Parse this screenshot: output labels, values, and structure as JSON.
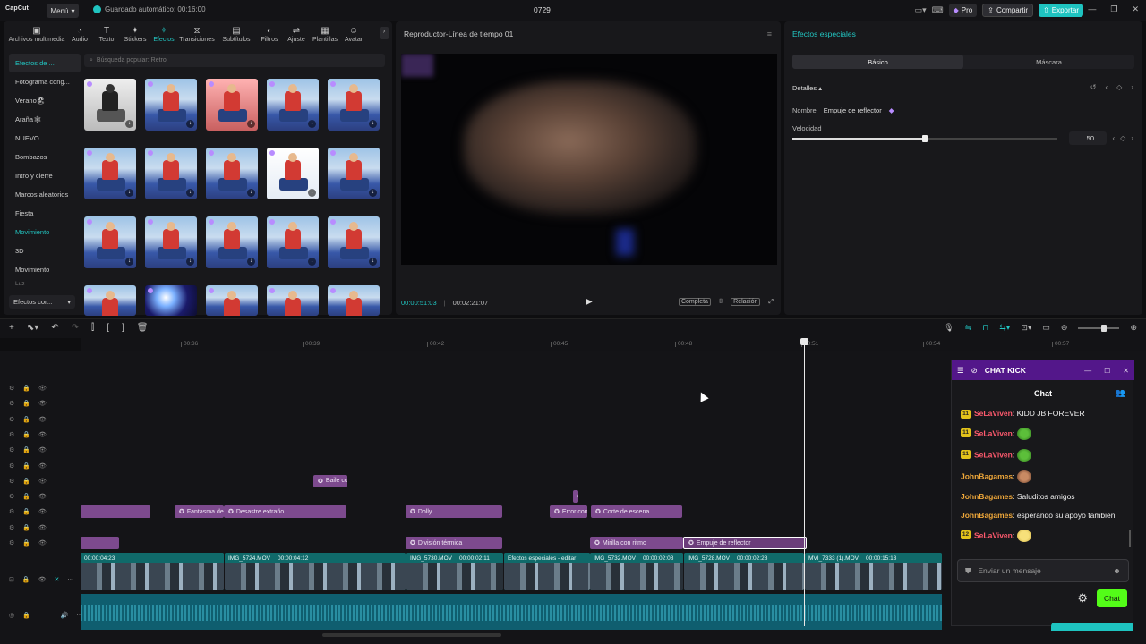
{
  "app": {
    "logo": "CapCut",
    "menu_label": "Menú",
    "autosave": "Guardado automático: 00:16:00",
    "project_name": "0729",
    "pro_label": "Pro",
    "share_label": "Compartir",
    "export_label": "Exportar"
  },
  "media": {
    "tabs": [
      {
        "label": "Archivos multimedia",
        "icon": "media-icon"
      },
      {
        "label": "Audio",
        "icon": "audio-icon"
      },
      {
        "label": "Texto",
        "icon": "text-icon"
      },
      {
        "label": "Stickers",
        "icon": "sticker-icon"
      },
      {
        "label": "Efectos",
        "icon": "effects-icon"
      },
      {
        "label": "Transiciones",
        "icon": "transition-icon"
      },
      {
        "label": "Subtítulos",
        "icon": "subtitle-icon"
      },
      {
        "label": "Filtros",
        "icon": "filter-icon"
      },
      {
        "label": "Ajuste",
        "icon": "adjust-icon"
      },
      {
        "label": "Plantillas",
        "icon": "template-icon"
      },
      {
        "label": "Avatar",
        "icon": "avatar-icon"
      }
    ],
    "categories": [
      "Efectos de ...",
      "Fotograma cong...",
      "Verano🏖",
      "Araña🕸",
      "NUEVO",
      "Bombazos",
      "Intro y cierre",
      "Marcos aleatorios",
      "Fiesta",
      "Movimiento",
      "3D",
      "Movimiento",
      "Luz"
    ],
    "category_dropdown": "Efectos cor...",
    "search_placeholder": "Búsqueda popular: Retro",
    "effects": [
      {
        "label": "Mundo extraño",
        "style": "bw"
      },
      {
        "label": "Corte estático",
        "style": "sky"
      },
      {
        "label": "Marco ...clonar",
        "style": "red"
      },
      {
        "label": "Ritmo brillante",
        "style": "sky"
      },
      {
        "label": "Volteo de látigo",
        "style": "sky"
      },
      {
        "label": "Empuje...lector",
        "style": "sky"
      },
      {
        "label": "Oscilac...lástica",
        "style": "sky"
      },
      {
        "label": "Impres...rdecer",
        "style": "sky"
      },
      {
        "label": "Atarde...ral 4x",
        "style": "bright"
      },
      {
        "label": "Latido",
        "style": "sky"
      },
      {
        "label": "Mini zoom",
        "style": "sky"
      },
      {
        "label": "Balance... brillo",
        "style": "sky"
      },
      {
        "label": "Suave",
        "style": "sky"
      },
      {
        "label": "Pintura... fútbol",
        "style": "sky"
      },
      {
        "label": "Lente... zoom",
        "style": "sky"
      },
      {
        "label": "",
        "style": "sky"
      },
      {
        "label": "",
        "style": "glow"
      },
      {
        "label": "",
        "style": "sky"
      },
      {
        "label": "",
        "style": "sky"
      },
      {
        "label": "",
        "style": "sky"
      }
    ]
  },
  "player": {
    "title": "Reproductor-Línea de tiempo 01",
    "current_time": "00:00:51:03",
    "total_time": "00:02:21:07",
    "complete_label": "Completa",
    "ratio_label": "Relación"
  },
  "fx": {
    "title": "Efectos especiales",
    "tab_basic": "Básico",
    "tab_mask": "Máscara",
    "details_label": "Detalles",
    "name_label": "Nombre",
    "name_value": "Empuje de reflector",
    "speed_label": "Velocidad",
    "speed_value": "50",
    "speed_fraction": 0.5
  },
  "ruler": [
    "00:36",
    "00:39",
    "00:42",
    "00:45",
    "00:48",
    "00:51",
    "00:54",
    "00:57"
  ],
  "timeline": {
    "fx_clips": [
      {
        "label": "Baile co",
        "row": 6
      },
      {
        "label": "",
        "row": 7
      },
      {
        "label": "",
        "row": 8
      },
      {
        "label": "Fantasma de",
        "row": 8
      },
      {
        "label": "Desastre extraño",
        "row": 8
      },
      {
        "label": "Dolly",
        "row": 8
      },
      {
        "label": "Error con",
        "row": 8
      },
      {
        "label": "Corte de escena",
        "row": 8
      },
      {
        "label": "",
        "row": 10
      },
      {
        "label": "División térmica",
        "row": 10
      },
      {
        "label": "Mirilla con ritmo",
        "row": 10
      },
      {
        "label": "Empuje de reflector",
        "row": 10,
        "selected": true
      }
    ],
    "video_clips": [
      {
        "name": "",
        "dur": "00:00:04:23"
      },
      {
        "name": "IMG_5724.MOV",
        "dur": "00:00:04:12"
      },
      {
        "name": "IMG_5730.MOV",
        "dur": "00:00:02:11"
      },
      {
        "name": "Efectos especiales - editar",
        "dur": ""
      },
      {
        "name": "IMG_5732.MOV",
        "dur": "00:00:02:08"
      },
      {
        "name": "IMG_5728.MOV",
        "dur": "00:00:02:28"
      },
      {
        "name": "MVI_7333 (1).MOV",
        "dur": "00:00:15:13"
      }
    ]
  },
  "chat": {
    "title": "CHAT KICK",
    "header": "Chat",
    "messages": [
      {
        "badge": "11",
        "user": "SeLaViven",
        "text": ": KIDD JB FOREVER",
        "color": "#ff5a6e",
        "emote": ""
      },
      {
        "badge": "11",
        "user": "SeLaViven",
        "text": ":",
        "color": "#ff5a6e",
        "emote": "pepe"
      },
      {
        "badge": "11",
        "user": "SeLaViven",
        "text": ":",
        "color": "#ff5a6e",
        "emote": "pepe"
      },
      {
        "badge": "",
        "user": "JohnBagames",
        "text": ":",
        "color": "#f0a83a",
        "emote": "face"
      },
      {
        "badge": "",
        "user": "JohnBagames",
        "text": ": Saluditos amigos",
        "color": "#f0a83a",
        "emote": ""
      },
      {
        "badge": "",
        "user": "JohnBagames",
        "text": ": esperando su apoyo tambien",
        "color": "#f0a83a",
        "emote": ""
      },
      {
        "badge": "12",
        "user": "SeLaViven",
        "text": ":",
        "color": "#ff5a6e",
        "emote": "smile"
      }
    ],
    "input_placeholder": "Enviar un mensaje",
    "send_label": "Chat"
  }
}
